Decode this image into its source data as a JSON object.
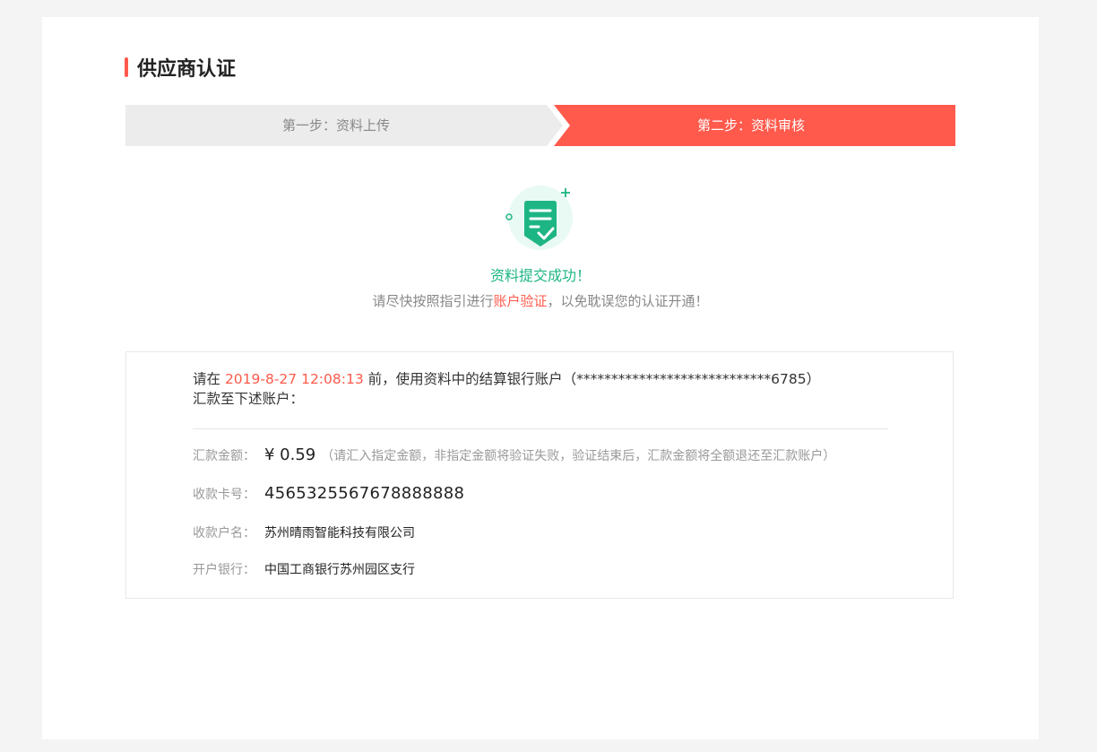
{
  "page": {
    "title": "供应商认证"
  },
  "steps": [
    {
      "label": "第一步：资料上传",
      "active": false
    },
    {
      "label": "第二步：资料审核",
      "active": true
    }
  ],
  "colors": {
    "accent": "#ff5a4c",
    "success": "#1db584",
    "inactive_step": "#ececec"
  },
  "result": {
    "icon": "document-check-icon",
    "title": "资料提交成功！",
    "desc_prefix": "请尽快按照指引进行",
    "desc_link": "账户验证",
    "desc_suffix": "，以免耽误您的认证开通！"
  },
  "notice": {
    "prefix": "请在 ",
    "deadline": "2019-8-27 12:08:13",
    "middle": " 前，使用资料中的结算银行账户（****************************6785）",
    "line2": "汇款至下述账户："
  },
  "details": {
    "amount_label": "汇款金额：",
    "amount_value": "¥ 0.59",
    "amount_hint": "（请汇入指定金额，非指定金额将验证失败，验证结束后，汇款金额将全额退还至汇款账户）",
    "card_label": "收款卡号：",
    "card_value": "4565325567678888888",
    "name_label": "收款户名：",
    "name_value": "苏州晴雨智能科技有限公司",
    "bank_label": "开户银行：",
    "bank_value": "中国工商银行苏州园区支行"
  }
}
